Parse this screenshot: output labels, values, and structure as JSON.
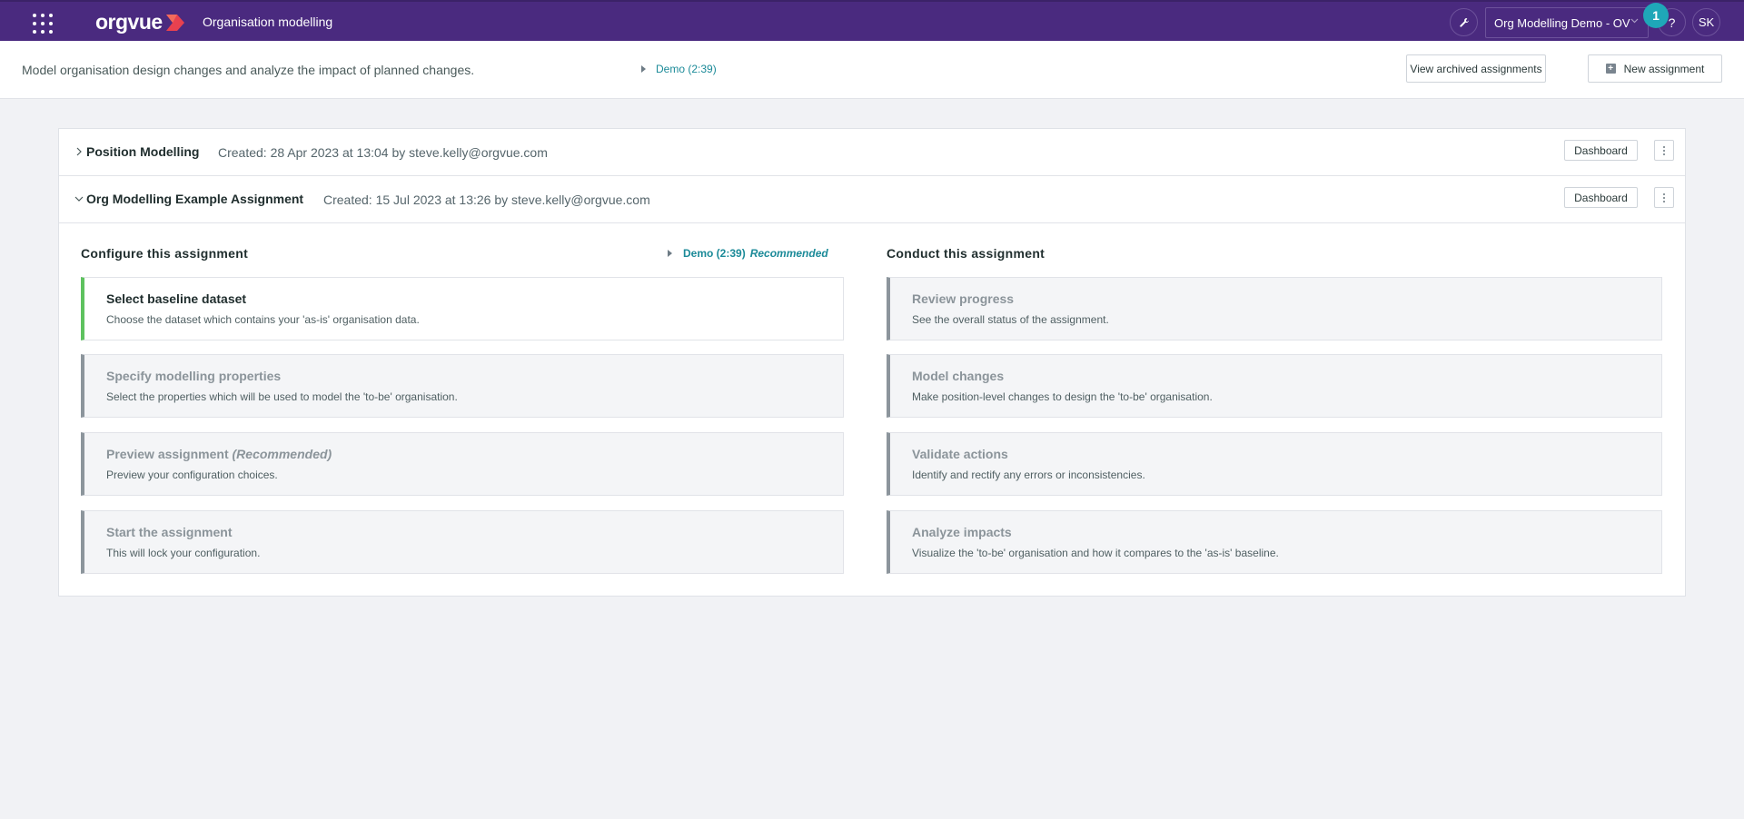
{
  "topbar": {
    "logo_text": "orgvue",
    "app_title": "Organisation modelling",
    "workspace": "Org Modelling Demo - OV",
    "help_label": "?",
    "notification_count": "1",
    "user_initials": "SK",
    "background_color": "#4a2a7f",
    "badge_color": "#1fa7b8"
  },
  "subheader": {
    "description": "Model organisation design changes and analyze the impact of planned changes.",
    "demo_label": "Demo (2:39)",
    "view_archived_label": "View archived assignments",
    "new_assignment_label": "New assignment"
  },
  "assignments": [
    {
      "title": "Position Modelling",
      "meta": "Created: 28 Apr 2023 at 13:04 by steve.kelly@orgvue.com",
      "dashboard_label": "Dashboard",
      "expanded": false
    },
    {
      "title": "Org Modelling Example Assignment",
      "meta": "Created: 15 Jul 2023 at 13:26 by steve.kelly@orgvue.com",
      "dashboard_label": "Dashboard",
      "expanded": true
    }
  ],
  "configure": {
    "heading": "Configure this assignment",
    "demo_time": "Demo (2:39)",
    "demo_recommended": "Recommended",
    "steps": [
      {
        "title": "Select baseline dataset",
        "desc": "Choose the dataset which contains your 'as-is' organisation data.",
        "active": true
      },
      {
        "title": "Specify modelling properties",
        "desc": "Select the properties which will be used to model the 'to-be' organisation.",
        "active": false
      },
      {
        "title": "Preview assignment",
        "title_suffix": "(Recommended)",
        "desc": "Preview your configuration choices.",
        "active": false
      },
      {
        "title": "Start the assignment",
        "desc": "This will lock your configuration.",
        "active": false
      }
    ]
  },
  "conduct": {
    "heading": "Conduct this assignment",
    "steps": [
      {
        "title": "Review progress",
        "desc": "See the overall status of the assignment."
      },
      {
        "title": "Model changes",
        "desc": "Make position-level changes to design the 'to-be' organisation."
      },
      {
        "title": "Validate actions",
        "desc": "Identify and rectify any errors or inconsistencies."
      },
      {
        "title": "Analyze impacts",
        "desc": "Visualize the 'to-be' organisation and how it compares to the 'as-is' baseline."
      }
    ]
  },
  "colors": {
    "active_step_accent": "#5ec25f",
    "inactive_step_accent": "#8c959c",
    "link": "#1b8a98"
  }
}
